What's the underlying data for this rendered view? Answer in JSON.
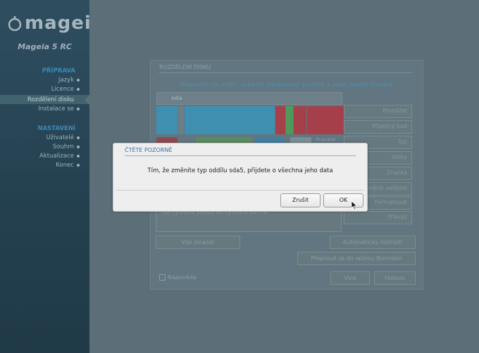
{
  "sidebar": {
    "logo": "mageia",
    "version": "Mageia 5 RC",
    "sections": [
      {
        "label": "PŘÍPRAVA",
        "items": [
          "Jazyk",
          "Licence",
          "Rozdělení disku",
          "Instalace se"
        ]
      },
      {
        "label": "NASTAVENÍ",
        "items": [
          "Uživatelé",
          "Souhrn",
          "Aktualizace",
          "Konec"
        ]
      }
    ]
  },
  "panel": {
    "title": "ROZDĚLENÍ DISKU",
    "instruction": "Klepněte na oddíl, vyberte souborový systém a poté zvolte činnost",
    "tab": "sda",
    "right_buttons": [
      "Prohlížet",
      "Připojný bod",
      "Typ",
      "Volby",
      "Značka",
      "Změnit velikost",
      "Formátovat",
      "Připojit"
    ],
    "info": "Od cylindru 16001 do cylindru 16578",
    "bottom_buttons": {
      "clear_all": "Vše smazat",
      "auto_allocate": "Automaticky rozmísti",
      "normal_mode": "Přepnout se do režimu Normální",
      "more": "Více",
      "done": "Hotovo"
    },
    "help": "Nápověda",
    "legend_empty": "Prázdné"
  },
  "dialog": {
    "title": "ČTĚTE POZORNĚ",
    "message": "Tím, že změníte typ oddílu sda5, přijdete o všechna jeho data",
    "cancel": "Zrušit",
    "ok": "OK"
  },
  "colors": {
    "sidebar_bg": "#2e4e60",
    "section_accent": "#3c89b6",
    "dialog_accent": "#3b6ea5"
  }
}
